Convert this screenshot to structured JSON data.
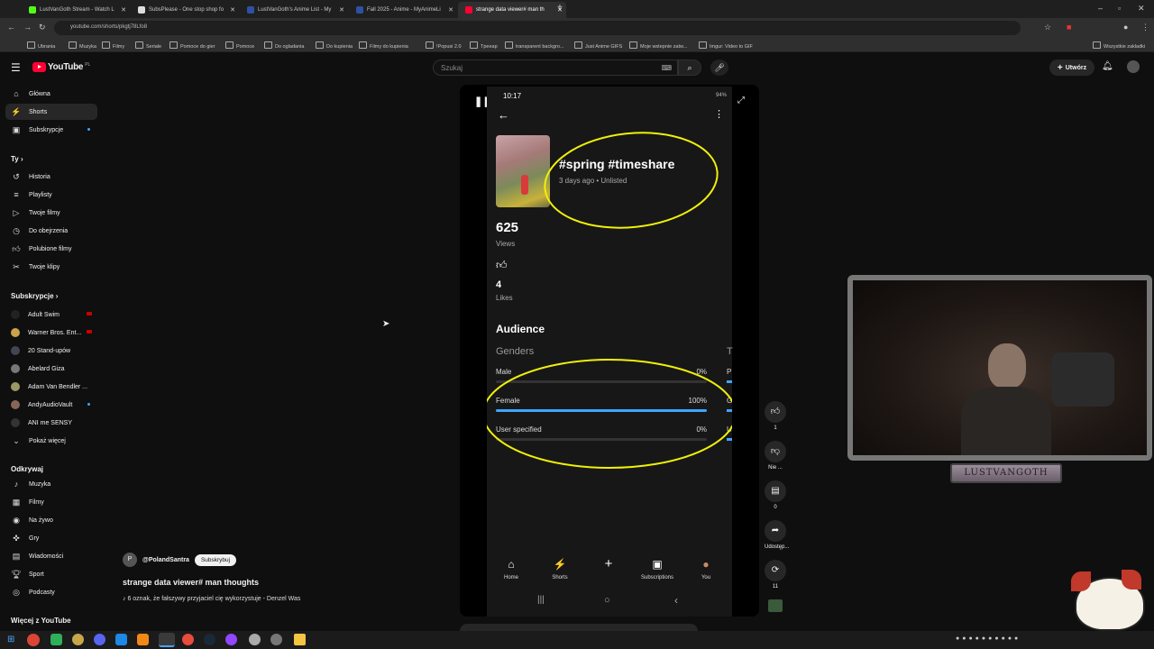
{
  "browser": {
    "tabs": [
      {
        "title": "LustVanGoth Stream - Watch L",
        "color": "#53fc18"
      },
      {
        "title": "SubsPlease - One stop shop fo",
        "color": "#ddd"
      },
      {
        "title": "LustVanGoth's Anime List - My",
        "color": "#2e51a2"
      },
      {
        "title": "Fall 2025 - Anime - MyAnimeLi",
        "color": "#2e51a2"
      },
      {
        "title": "strange data viewer# man th",
        "color": "#ff0033"
      }
    ],
    "url": "youtube.com/shorts/pkgtj78Lfo8",
    "bookmarks": [
      "Ubrania",
      "Muzyka",
      "Filmy",
      "Seriale",
      "Pomoce do gier",
      "Pomoce",
      "Do ogladania",
      "Do kupienia",
      "Filmy do kupienia",
      "!Popusi 2.0",
      "Tpeeap",
      "transparent backgro...",
      "Just Anime GIFS",
      "Moje wstepnie zatw...",
      "Imgur: Video to GIF",
      "Wszystkie zakladki"
    ]
  },
  "header": {
    "logo": "YouTube",
    "region": "PL",
    "search_placeholder": "Szukaj",
    "create_label": "Utwórz"
  },
  "sidebar": {
    "main": [
      {
        "label": "Główna",
        "icon": "home-icon"
      },
      {
        "label": "Shorts",
        "icon": "shorts-icon"
      },
      {
        "label": "Subskrypcje",
        "icon": "subscriptions-icon"
      }
    ],
    "you_header": "Ty",
    "you": [
      {
        "label": "Historia",
        "icon": "history-icon"
      },
      {
        "label": "Playlisty",
        "icon": "playlist-icon"
      },
      {
        "label": "Twoje filmy",
        "icon": "your-videos-icon"
      },
      {
        "label": "Do obejrzenia",
        "icon": "watch-later-icon"
      },
      {
        "label": "Polubione filmy",
        "icon": "liked-icon"
      },
      {
        "label": "Twoje klipy",
        "icon": "clips-icon"
      }
    ],
    "subs_header": "Subskrypcje",
    "subs": [
      {
        "label": "Adult Swim",
        "color": "#222"
      },
      {
        "label": "Warner Bros. Ent...",
        "color": "#c9a24b"
      },
      {
        "label": "20 Stand-upów",
        "color": "#445"
      },
      {
        "label": "Abelard Giza",
        "color": "#777"
      },
      {
        "label": "Adam Van Bendler ...",
        "color": "#996"
      },
      {
        "label": "AndyAudioVault",
        "color": "#865"
      },
      {
        "label": "ANI me SENSY",
        "color": "#333"
      }
    ],
    "show_more": "Pokaż więcej",
    "explore_header": "Odkrywaj",
    "explore": [
      {
        "label": "Muzyka",
        "icon": "music-icon"
      },
      {
        "label": "Filmy",
        "icon": "movies-icon"
      },
      {
        "label": "Na żywo",
        "icon": "live-icon"
      },
      {
        "label": "Gry",
        "icon": "gaming-icon"
      },
      {
        "label": "Wiadomości",
        "icon": "news-icon"
      },
      {
        "label": "Sport",
        "icon": "sport-icon"
      },
      {
        "label": "Podcasty",
        "icon": "podcast-icon"
      }
    ],
    "more_header": "Więcej z YouTube"
  },
  "short": {
    "channel": "@PolandSantra",
    "subscribe": "Subskrybuj",
    "title": "strange data viewer# man thoughts",
    "music": "♪ 6 oznak, że fałszywy przyjaciel cię wykorzystuje - Denzel Was",
    "likes": "1",
    "dislike": "Nie ...",
    "comments": "0",
    "share": "Udostęp...",
    "remix": "11"
  },
  "phone": {
    "time": "10:17",
    "battery": "94%",
    "post_title": "#spring #timeshare",
    "post_meta": "3 days ago • Unlisted",
    "views_value": "625",
    "views_label": "Views",
    "likes_value": "4",
    "likes_label": "Likes",
    "audience": "Audience",
    "genders": "Genders",
    "side_head": "T",
    "gender_rows": [
      {
        "label": "Male",
        "pct": "0%",
        "fraction": 0.0,
        "side": "P"
      },
      {
        "label": "Female",
        "pct": "100%",
        "fraction": 1.0,
        "side": "G"
      },
      {
        "label": "User specified",
        "pct": "0%",
        "fraction": 0.0,
        "side": "U"
      }
    ],
    "nav": [
      {
        "label": "Home",
        "icon": "home-icon"
      },
      {
        "label": "Shorts",
        "icon": "shorts-icon"
      },
      {
        "label": "",
        "icon": "add-icon"
      },
      {
        "label": "Subscriptions",
        "icon": "subscriptions-icon"
      },
      {
        "label": "You",
        "icon": "avatar-icon"
      }
    ]
  },
  "overlay": {
    "cam_label": "LUSTVANGOTH"
  },
  "colors": {
    "accent": "#3ea6ff",
    "highlight": "#f0f00a",
    "youtube_red": "#ff0033"
  }
}
